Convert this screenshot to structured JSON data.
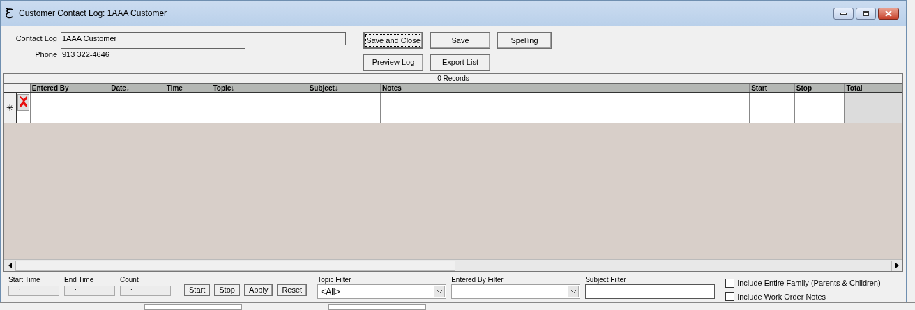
{
  "window": {
    "title": "Customer Contact Log: 1AAA Customer"
  },
  "fields": [
    {
      "label": "Contact Log",
      "value": "1AAA Customer"
    },
    {
      "label": "Phone",
      "value": "913 322-4646"
    }
  ],
  "buttons": [
    {
      "label": "Save and Close",
      "focused": true
    },
    {
      "label": "Save",
      "focused": false
    },
    {
      "label": "Spelling",
      "focused": false
    },
    {
      "label": "Preview Log",
      "focused": false
    },
    {
      "label": "Export List",
      "focused": false
    }
  ],
  "record_count": "0 Records",
  "table": {
    "new_row_marker": "✳",
    "columns": [
      "Entered By",
      "Date↓",
      "Time",
      "Topic↓",
      "Subject↓",
      "Notes",
      "Start",
      "Stop",
      "Total"
    ]
  },
  "footer": {
    "time_fields": [
      {
        "label": "Start Time",
        "value": ":"
      },
      {
        "label": "End Time",
        "value": ":"
      },
      {
        "label": "Count",
        "value": ":"
      }
    ],
    "buttons": [
      "Start",
      "Stop",
      "Apply",
      "Reset"
    ],
    "topic_filter": {
      "label": "Topic Filter",
      "value": "<All>"
    },
    "entered_by_filter": {
      "label": "Entered By Filter"
    },
    "subject_filter": {
      "label": "Subject Filter"
    },
    "checkboxes": [
      {
        "label": "Include Entire Family (Parents & Children)",
        "checked": false
      },
      {
        "label": "Include Work Order Notes",
        "checked": false
      }
    ]
  }
}
